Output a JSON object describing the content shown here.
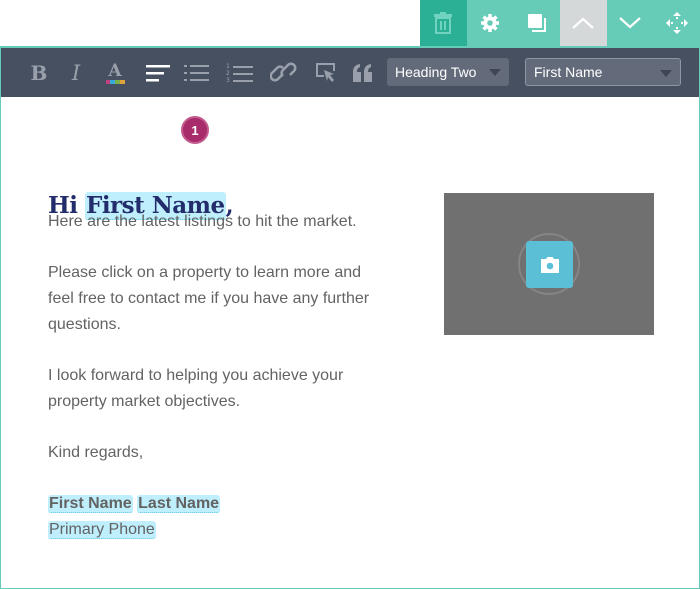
{
  "block_toolbar": {
    "buttons": [
      {
        "name": "trash-button",
        "icon": "trash-icon"
      },
      {
        "name": "settings-button",
        "icon": "gear-icon"
      },
      {
        "name": "duplicate-button",
        "icon": "copy-icon"
      },
      {
        "name": "move-up-button",
        "icon": "chevron-up-icon"
      },
      {
        "name": "move-down-button",
        "icon": "chevron-down-icon"
      },
      {
        "name": "drag-button",
        "icon": "move-icon"
      }
    ]
  },
  "toolbar": {
    "heading_select": "Heading Two",
    "merge_field_select": "First Name",
    "text_color_swatches": [
      "#c2407f",
      "#3aa8d8",
      "#7bb04a",
      "#e0a53a"
    ]
  },
  "email": {
    "greeting_prefix": "Hi ",
    "greeting_field": "First Name",
    "greeting_suffix": ",",
    "badge": "1",
    "p1": "Here are the latest listings to hit the market.",
    "p2": "Please click on a property to learn more and feel free to contact me if you have any further questions.",
    "p3": "I look forward to helping you achieve your property market objectives.",
    "p4": "Kind regards,",
    "sig_first": "First Name",
    "sig_last": "Last Name",
    "sig_phone": "Primary Phone"
  },
  "colors": {
    "accent": "#66ccb8",
    "toolbar": "#475061",
    "heading": "#232d6b",
    "merge_tag": "#bfeefc",
    "badge": "#a82c6b"
  }
}
